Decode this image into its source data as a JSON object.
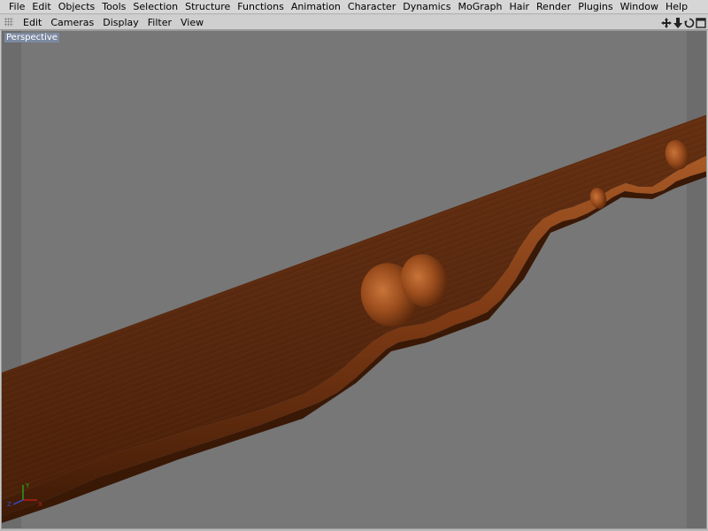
{
  "menubar": {
    "items": [
      "File",
      "Edit",
      "Objects",
      "Tools",
      "Selection",
      "Structure",
      "Functions",
      "Animation",
      "Character",
      "Dynamics",
      "MoGraph",
      "Hair",
      "Render",
      "Plugins",
      "Window",
      "Help"
    ]
  },
  "viewbar": {
    "items": [
      "Edit",
      "Cameras",
      "Display",
      "Filter",
      "View"
    ],
    "nav_icons": [
      "move-view-icon",
      "dolly-view-icon",
      "rotate-view-icon",
      "maximize-view-icon"
    ]
  },
  "viewport": {
    "label": "Perspective",
    "background": "#777777",
    "axis_labels": {
      "x": "X",
      "y": "Y",
      "z": "Z"
    }
  },
  "colors": {
    "wood_top": "#5a2a10",
    "wood_mid": "#8a4418",
    "wood_highlight": "#b0602a",
    "axis_x": "#c02020",
    "axis_y": "#20b020",
    "axis_z": "#3050d0"
  }
}
